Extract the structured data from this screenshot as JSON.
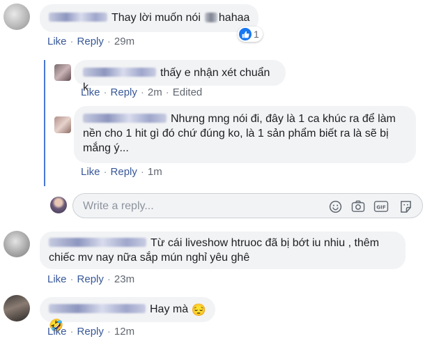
{
  "comments": [
    {
      "text": "Thay lời muốn nói",
      "text_after": "hahaa",
      "reaction_count": "1",
      "actions": {
        "like": "Like",
        "reply": "Reply",
        "time": "29m"
      }
    },
    {
      "text": "Từ cái liveshow htruoc đã bị bớt iu nhiu , thêm chiếc mv nay nữa sắp mún nghỉ yêu ghê",
      "actions": {
        "like": "Like",
        "reply": "Reply",
        "time": "23m"
      }
    },
    {
      "text": "Hay mà",
      "emojis": "😔🤣",
      "actions": {
        "like": "Like",
        "reply": "Reply",
        "time": "12m"
      }
    }
  ],
  "replies": [
    {
      "text": "thấy e nhận xét chuẩn k",
      "actions": {
        "like": "Like",
        "reply": "Reply",
        "time": "2m",
        "edited": "Edited"
      }
    },
    {
      "text": "Nhưng mng nói đi, đây là 1 ca khúc ra để làm nền cho 1 hit gì đó chứ đúng ko, là 1 sản phẩm biết ra là sẽ bị mắng ý...",
      "actions": {
        "like": "Like",
        "reply": "Reply",
        "time": "1m"
      }
    }
  ],
  "reply_box": {
    "placeholder": "Write a reply...",
    "icons": [
      "emoji-icon",
      "camera-icon",
      "gif-icon",
      "sticker-icon"
    ]
  },
  "colors": {
    "link": "#385898",
    "bubble": "#f2f3f5",
    "thread": "#4a76d4",
    "like_blue": "#1877f2"
  }
}
